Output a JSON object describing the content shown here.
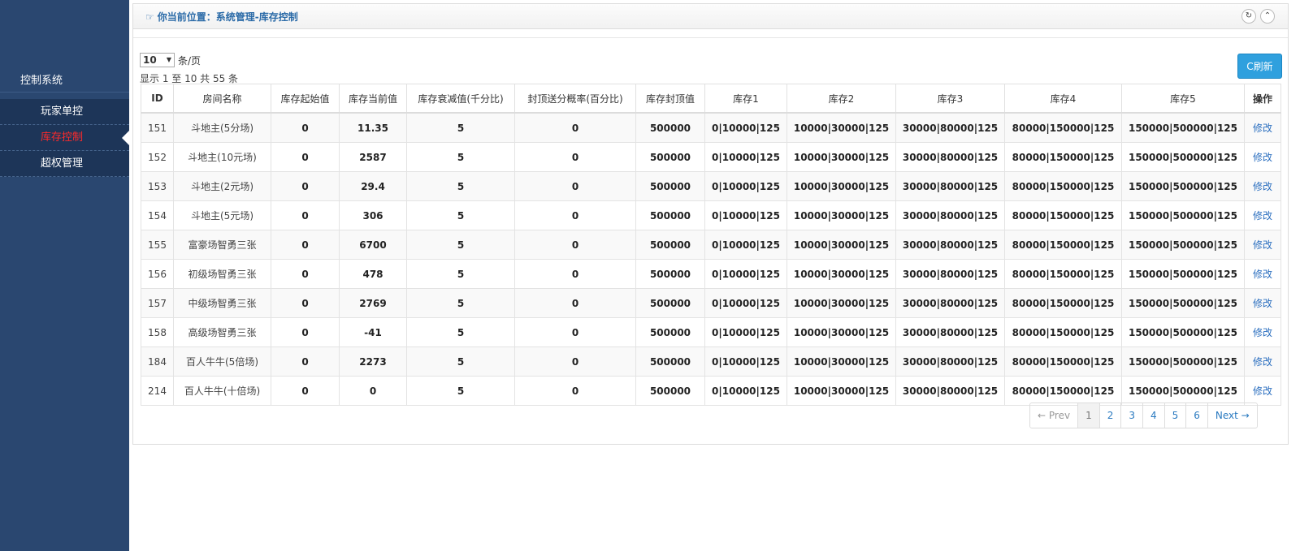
{
  "sidebar": {
    "system_title": "控制系统",
    "items": [
      {
        "label": "玩家单控",
        "active": false
      },
      {
        "label": "库存控制",
        "active": true
      },
      {
        "label": "超权管理",
        "active": false
      }
    ]
  },
  "header": {
    "breadcrumb_icon": "☞",
    "breadcrumb": "你当前位置：系统管理-库存控制",
    "reload_icon": "↻",
    "collapse_icon": "⌃"
  },
  "controls": {
    "page_size": "10",
    "page_size_caret": "▼",
    "page_size_unit": "条/页",
    "info": "显示 1 至 10 共 55 条",
    "refresh_label": "C刷新"
  },
  "table": {
    "columns": [
      "ID",
      "房间名称",
      "库存起始值",
      "库存当前值",
      "库存衰减值(千分比)",
      "封顶送分概率(百分比)",
      "库存封顶值",
      "库存1",
      "库存2",
      "库存3",
      "库存4",
      "库存5",
      "操作"
    ],
    "rows": [
      [
        "151",
        "斗地主(5分场)",
        "0",
        "11.35",
        "5",
        "0",
        "500000",
        "0|10000|125",
        "10000|30000|125",
        "30000|80000|125",
        "80000|150000|125",
        "150000|500000|125",
        "修改"
      ],
      [
        "152",
        "斗地主(10元场)",
        "0",
        "2587",
        "5",
        "0",
        "500000",
        "0|10000|125",
        "10000|30000|125",
        "30000|80000|125",
        "80000|150000|125",
        "150000|500000|125",
        "修改"
      ],
      [
        "153",
        "斗地主(2元场)",
        "0",
        "29.4",
        "5",
        "0",
        "500000",
        "0|10000|125",
        "10000|30000|125",
        "30000|80000|125",
        "80000|150000|125",
        "150000|500000|125",
        "修改"
      ],
      [
        "154",
        "斗地主(5元场)",
        "0",
        "306",
        "5",
        "0",
        "500000",
        "0|10000|125",
        "10000|30000|125",
        "30000|80000|125",
        "80000|150000|125",
        "150000|500000|125",
        "修改"
      ],
      [
        "155",
        "富豪场智勇三张",
        "0",
        "6700",
        "5",
        "0",
        "500000",
        "0|10000|125",
        "10000|30000|125",
        "30000|80000|125",
        "80000|150000|125",
        "150000|500000|125",
        "修改"
      ],
      [
        "156",
        "初级场智勇三张",
        "0",
        "478",
        "5",
        "0",
        "500000",
        "0|10000|125",
        "10000|30000|125",
        "30000|80000|125",
        "80000|150000|125",
        "150000|500000|125",
        "修改"
      ],
      [
        "157",
        "中级场智勇三张",
        "0",
        "2769",
        "5",
        "0",
        "500000",
        "0|10000|125",
        "10000|30000|125",
        "30000|80000|125",
        "80000|150000|125",
        "150000|500000|125",
        "修改"
      ],
      [
        "158",
        "高级场智勇三张",
        "0",
        "-41",
        "5",
        "0",
        "500000",
        "0|10000|125",
        "10000|30000|125",
        "30000|80000|125",
        "80000|150000|125",
        "150000|500000|125",
        "修改"
      ],
      [
        "184",
        "百人牛牛(5倍场)",
        "0",
        "2273",
        "5",
        "0",
        "500000",
        "0|10000|125",
        "10000|30000|125",
        "30000|80000|125",
        "80000|150000|125",
        "150000|500000|125",
        "修改"
      ],
      [
        "214",
        "百人牛牛(十倍场)",
        "0",
        "0",
        "5",
        "0",
        "500000",
        "0|10000|125",
        "10000|30000|125",
        "30000|80000|125",
        "80000|150000|125",
        "150000|500000|125",
        "修改"
      ]
    ]
  },
  "pagination": {
    "prev": "← Prev",
    "pages": [
      "1",
      "2",
      "3",
      "4",
      "5",
      "6"
    ],
    "current": "1",
    "next": "Next →"
  }
}
